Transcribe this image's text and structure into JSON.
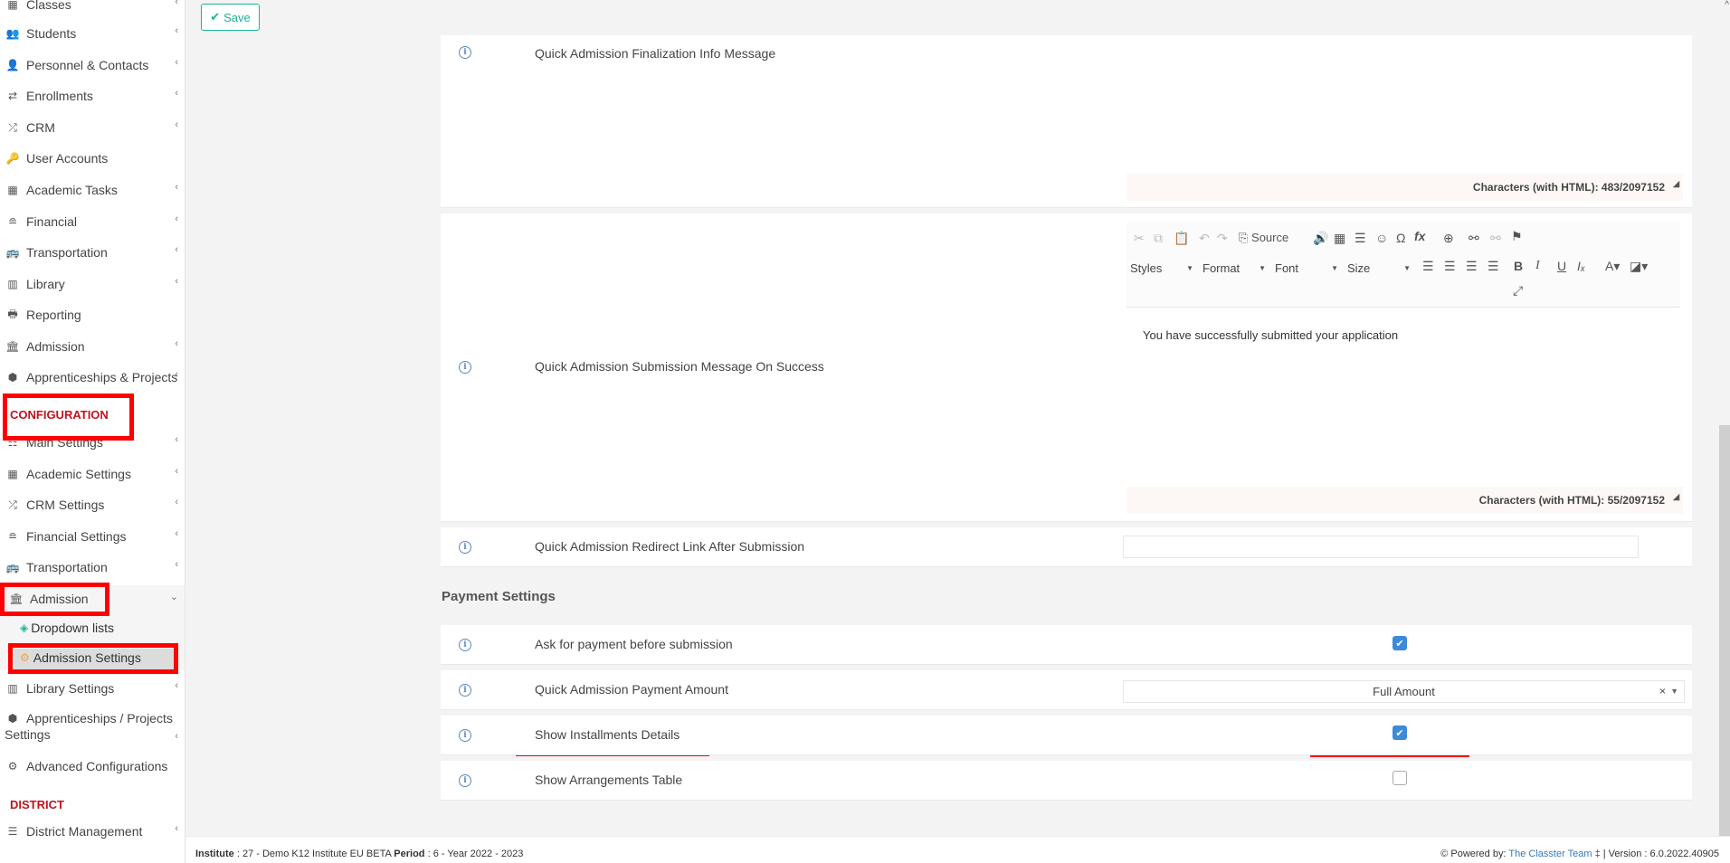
{
  "toolbar": {
    "save_label": "Save"
  },
  "sidebar": {
    "items": [
      {
        "label": "Classes",
        "icon": "classes-icon"
      },
      {
        "label": "Students",
        "icon": "students-icon"
      },
      {
        "label": "Personnel & Contacts",
        "icon": "personnel-icon"
      },
      {
        "label": "Enrollments",
        "icon": "enrollments-icon"
      },
      {
        "label": "CRM",
        "icon": "crm-icon"
      },
      {
        "label": "User Accounts",
        "icon": "user-accounts-icon"
      },
      {
        "label": "Academic Tasks",
        "icon": "academic-tasks-icon"
      },
      {
        "label": "Financial",
        "icon": "financial-icon"
      },
      {
        "label": "Transportation",
        "icon": "bus-icon"
      },
      {
        "label": "Library",
        "icon": "library-icon"
      },
      {
        "label": "Reporting",
        "icon": "printer-icon"
      },
      {
        "label": "Admission",
        "icon": "institution-icon"
      },
      {
        "label": "Apprenticeships & Projects",
        "icon": "cube-icon"
      }
    ],
    "configuration_label": "CONFIGURATION",
    "config_items": [
      {
        "label": "Main Settings"
      },
      {
        "label": "Academic Settings"
      },
      {
        "label": "CRM Settings"
      },
      {
        "label": "Financial Settings"
      },
      {
        "label": "Transportation"
      },
      {
        "label": "Admission"
      },
      {
        "label": "Dropdown lists"
      },
      {
        "label": "Admission Settings"
      },
      {
        "label": "Library Settings"
      },
      {
        "label": "Apprenticeships / Projects"
      },
      {
        "label": "Settings"
      },
      {
        "label": "Advanced Configurations"
      }
    ],
    "district_label": "DISTRICT",
    "district_items": [
      {
        "label": "District Management"
      }
    ]
  },
  "rows": {
    "finalization_label": "Quick Admission Finalization Info Message",
    "finalization_chars": "Characters (with HTML): 483/2097152",
    "success_label": "Quick Admission Submission Message On Success",
    "success_chars": "Characters (with HTML): 55/2097152",
    "success_body": "You have successfully submitted your application",
    "redirect_label": "Quick Admission Redirect Link After Submission"
  },
  "editor": {
    "source_label": "Source",
    "styles_label": "Styles",
    "format_label": "Format",
    "font_label": "Font",
    "size_label": "Size"
  },
  "payment": {
    "section_title": "Payment Settings",
    "ask_payment_label": "Ask for payment before submission",
    "ask_payment_checked": true,
    "amount_label": "Quick Admission Payment Amount",
    "amount_value": "Full Amount",
    "installments_label": "Show Installments Details",
    "installments_checked": true,
    "arrangements_label": "Show Arrangements Table",
    "arrangements_checked": false
  },
  "footer": {
    "institute_key": "Institute",
    "institute_value": ": 27 - Demo K12 Institute EU BETA",
    "period_key": "Period",
    "period_value": ": 6 - Year 2022 - 2023",
    "powered_by": "Powered by:",
    "team_link": "The Classter Team",
    "version": "| Version : 6.0.2022.40905"
  },
  "colors": {
    "accent": "#1ab394",
    "config_red": "#c0141c",
    "highlight": "#ff0000",
    "checkbox": "#3d8ad8"
  }
}
